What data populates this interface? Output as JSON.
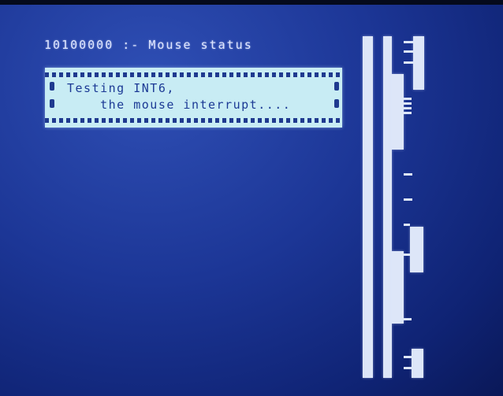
{
  "status_line": "10100000 :- Mouse status",
  "message": {
    "line1": "Testing INT6,",
    "line2": "    the mouse interrupt...."
  },
  "colors": {
    "screen_blue": "#1c3696",
    "box_fill": "#c8ecf4",
    "text_light": "#dfe6ff",
    "text_dark": "#1c3a95"
  }
}
